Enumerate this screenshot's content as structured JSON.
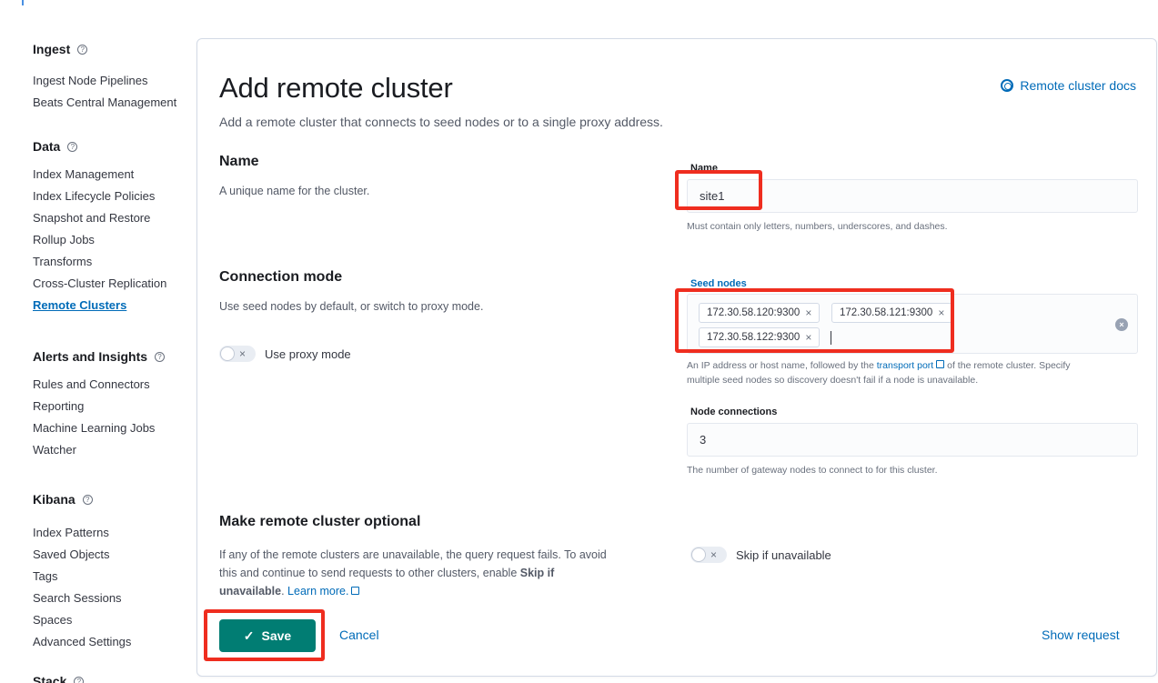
{
  "sidebar": {
    "groups": [
      {
        "title": "Ingest",
        "items": [
          "Ingest Node Pipelines",
          "Beats Central Management"
        ]
      },
      {
        "title": "Data",
        "items": [
          "Index Management",
          "Index Lifecycle Policies",
          "Snapshot and Restore",
          "Rollup Jobs",
          "Transforms",
          "Cross-Cluster Replication",
          "Remote Clusters"
        ]
      },
      {
        "title": "Alerts and Insights",
        "items": [
          "Rules and Connectors",
          "Reporting",
          "Machine Learning Jobs",
          "Watcher"
        ]
      },
      {
        "title": "Kibana",
        "items": [
          "Index Patterns",
          "Saved Objects",
          "Tags",
          "Search Sessions",
          "Spaces",
          "Advanced Settings"
        ]
      },
      {
        "title": "Stack"
      }
    ],
    "active_item": "Remote Clusters",
    "help_glyph": "?"
  },
  "page": {
    "title": "Add remote cluster",
    "docs_link": "Remote cluster docs",
    "subtitle": "Add a remote cluster that connects to seed nodes or to a single proxy address."
  },
  "name_section": {
    "title": "Name",
    "description": "A unique name for the cluster.",
    "field_label": "Name",
    "value": "site1",
    "help": "Must contain only letters, numbers, underscores, and dashes."
  },
  "connection_section": {
    "title": "Connection mode",
    "description": "Use seed nodes by default, or switch to proxy mode.",
    "proxy_toggle_label": "Use proxy mode",
    "seed_label": "Seed nodes",
    "seed_nodes": [
      "172.30.58.120:9300",
      "172.30.58.121:9300",
      "172.30.58.122:9300"
    ],
    "seed_help_pre": "An IP address or host name, followed by the ",
    "seed_help_link": "transport port",
    "seed_help_post": " of the remote cluster. Specify",
    "seed_help_line2": "multiple seed nodes so discovery doesn't fail if a node is unavailable.",
    "node_conn_label": "Node connections",
    "node_conn_value": "3",
    "node_conn_help": "The number of gateway nodes to connect to for this cluster."
  },
  "optional_section": {
    "title": "Make remote cluster optional",
    "desc_line1": "If any of the remote clusters are unavailable, the query request fails. To avoid",
    "desc_line2_pre": "this and continue to send requests to other clusters, enable ",
    "desc_bold1": "Skip if",
    "desc_bold2": "unavailable",
    "desc_line3_post": ". ",
    "learn_more": "Learn more.",
    "skip_toggle_label": "Skip if unavailable"
  },
  "actions": {
    "save": "Save",
    "cancel": "Cancel",
    "show_request": "Show request"
  },
  "icons": {
    "toggle_off": "×",
    "chip_remove": "×",
    "clear": "×",
    "save_check": "✓"
  },
  "colors": {
    "accent": "#006bb8",
    "save_button": "#017d73",
    "highlight": "#ef2d1f"
  }
}
